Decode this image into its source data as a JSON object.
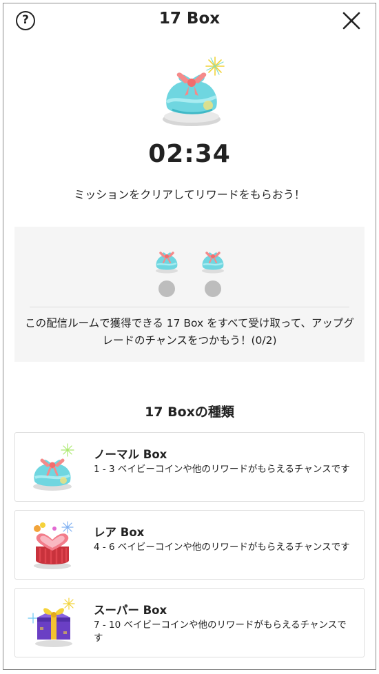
{
  "header": {
    "title": "17 Box",
    "help_icon": "help-circle-icon",
    "close_icon": "close-x-icon"
  },
  "hero": {
    "timer": "02:34",
    "mission_text": "ミッションをクリアしてリワードをもらおう！"
  },
  "progress": {
    "collected": 0,
    "total": 2,
    "description": "この配信ルームで獲得できる 17 Box をすべて受け取って、アップグレードのチャンスをつかもう！(0/2)"
  },
  "box_types": {
    "title": "17 Boxの種類",
    "items": [
      {
        "name": "ノーマル Box",
        "description": "1 - 3 ベイビーコインや他のリワードがもらえるチャンスです",
        "icon": "normal-box-icon"
      },
      {
        "name": "レア Box",
        "description": "4 - 6 ベイビーコインや他のリワードがもらえるチャンスです",
        "icon": "rare-box-icon"
      },
      {
        "name": "スーパー Box",
        "description": "7 - 10 ベイビーコインや他のリワードがもらえるチャンスです",
        "icon": "super-box-icon"
      }
    ]
  },
  "colors": {
    "text": "#222222",
    "panel_bg": "#f5f5f5",
    "dot_inactive": "#bdbdbd",
    "normal_box": "#6fd6e0",
    "ribbon": "#f58a8a",
    "rare_box": "#e0454f",
    "super_box": "#6a3fc4",
    "super_ribbon": "#f2c230"
  }
}
